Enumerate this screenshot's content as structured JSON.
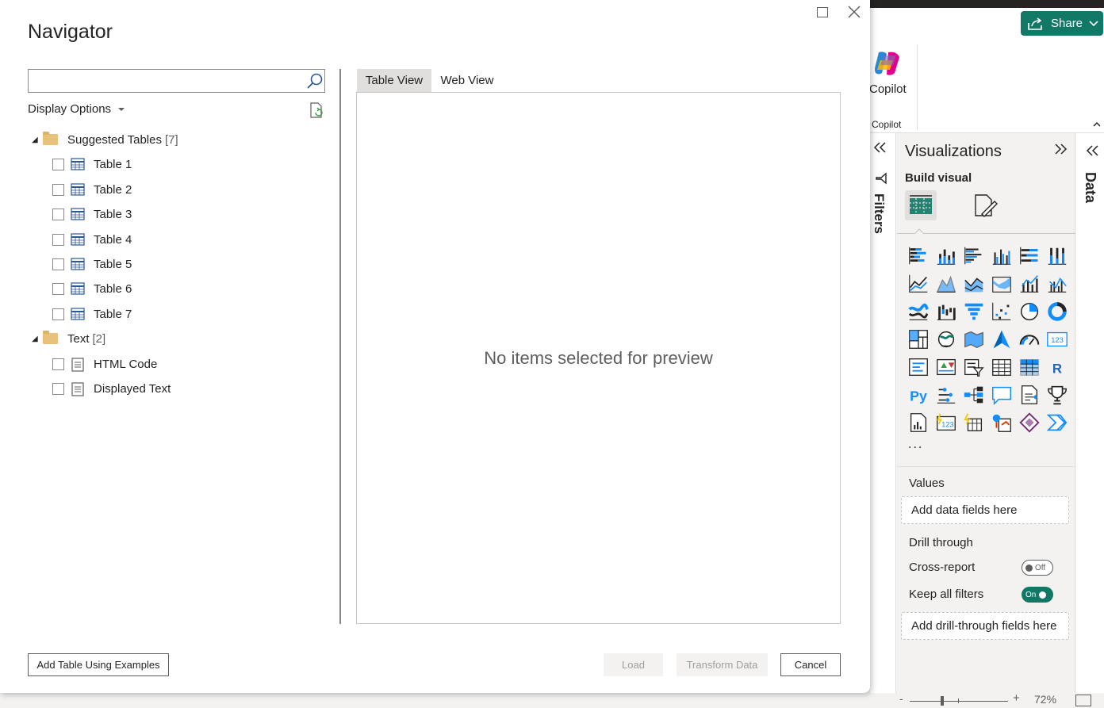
{
  "dialog": {
    "title": "Navigator",
    "search": {
      "value": "",
      "placeholder": ""
    },
    "display_options_label": "Display Options",
    "tree": {
      "groups": [
        {
          "label": "Suggested Tables",
          "count": "[7]",
          "expanded": true,
          "items": [
            {
              "label": "Table 1",
              "icon": "table-icon",
              "checked": false
            },
            {
              "label": "Table 2",
              "icon": "table-icon",
              "checked": false
            },
            {
              "label": "Table 3",
              "icon": "table-icon",
              "checked": false
            },
            {
              "label": "Table 4",
              "icon": "table-icon",
              "checked": false
            },
            {
              "label": "Table 5",
              "icon": "table-icon",
              "checked": false
            },
            {
              "label": "Table 6",
              "icon": "table-icon",
              "checked": false
            },
            {
              "label": "Table 7",
              "icon": "table-icon",
              "checked": false
            }
          ]
        },
        {
          "label": "Text",
          "count": "[2]",
          "expanded": true,
          "items": [
            {
              "label": "HTML Code",
              "icon": "document-icon",
              "checked": false
            },
            {
              "label": "Displayed Text",
              "icon": "document-icon",
              "checked": false
            }
          ]
        }
      ]
    },
    "tabs": [
      {
        "label": "Table View",
        "active": true
      },
      {
        "label": "Web View",
        "active": false
      }
    ],
    "preview_empty_text": "No items selected for preview",
    "buttons": {
      "add_table": "Add Table Using Examples",
      "load": "Load",
      "transform": "Transform Data",
      "cancel": "Cancel"
    }
  },
  "app": {
    "share_label": "Share",
    "copilot_label": "Copilot",
    "copilot_group_label": "Copilot",
    "filters_label": "Filters",
    "data_label": "Data",
    "visualizations": {
      "title": "Visualizations",
      "build_visual_label": "Build visual",
      "more_label": "...",
      "values_label": "Values",
      "values_placeholder": "Add data fields here",
      "drill_through_label": "Drill through",
      "cross_report_label": "Cross-report",
      "cross_report_state": "Off",
      "keep_filters_label": "Keep all filters",
      "keep_filters_state": "On",
      "drill_placeholder": "Add drill-through fields here"
    },
    "zoom": {
      "minus": "-",
      "plus": "+",
      "value": "72%"
    }
  },
  "colors": {
    "accent": "#117865",
    "viz_blue": "#118dff",
    "viz_dark": "#252423"
  }
}
